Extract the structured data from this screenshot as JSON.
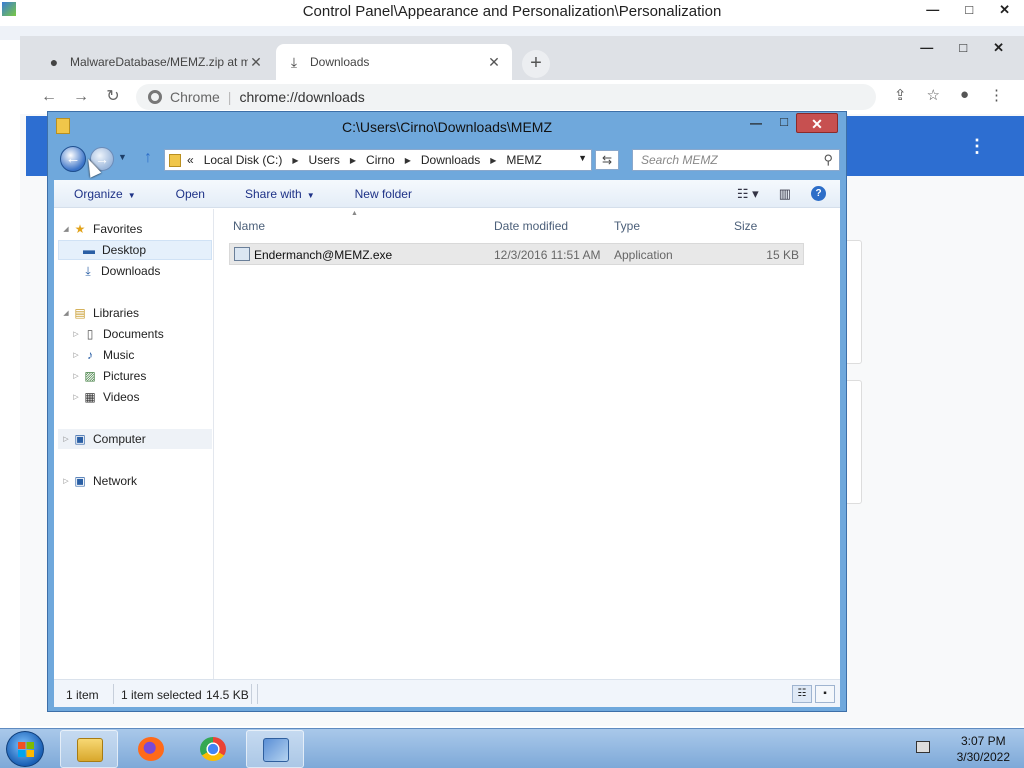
{
  "control_panel": {
    "title": "Control Panel\\Appearance and Personalization\\Personalization",
    "minimize": "—",
    "maximize": "□",
    "close": "✕"
  },
  "chrome": {
    "tabs": [
      {
        "label": "MalwareDatabase/MEMZ.zip at m",
        "icon": "github-icon",
        "close": "✕"
      },
      {
        "label": "Downloads",
        "icon": "download-icon",
        "close": "✕"
      }
    ],
    "new_tab": "+",
    "minimize": "—",
    "maximize": "□",
    "close": "✕",
    "omnibox": {
      "scheme_label": "Chrome",
      "separator": "|",
      "url": "chrome://downloads"
    },
    "downloads_menu": "⋮"
  },
  "explorer": {
    "title": "C:\\Users\\Cirno\\Downloads\\MEMZ",
    "minimize": "—",
    "maximize": "□",
    "close": "✕",
    "address": {
      "prefix": "«",
      "crumbs": [
        "Local Disk (C:)",
        "Users",
        "Cirno",
        "Downloads",
        "MEMZ"
      ]
    },
    "search_placeholder": "Search MEMZ",
    "commands": {
      "organize": "Organize",
      "open": "Open",
      "share_with": "Share with",
      "new_folder": "New folder"
    },
    "nav": {
      "favorites": "Favorites",
      "desktop": "Desktop",
      "downloads": "Downloads",
      "libraries": "Libraries",
      "documents": "Documents",
      "music": "Music",
      "pictures": "Pictures",
      "videos": "Videos",
      "computer": "Computer",
      "network": "Network"
    },
    "columns": {
      "name": "Name",
      "date": "Date modified",
      "type": "Type",
      "size": "Size"
    },
    "files": [
      {
        "name": "Endermanch@MEMZ.exe",
        "date": "12/3/2016 11:51 AM",
        "type": "Application",
        "size": "15 KB"
      }
    ],
    "status": {
      "count": "1 item",
      "selected": "1 item selected",
      "selected_size": "14.5 KB"
    }
  },
  "taskbar": {
    "apps": [
      "file-explorer",
      "firefox",
      "chrome",
      "control-panel"
    ],
    "time": "3:07 PM",
    "date": "3/30/2022"
  },
  "colors": {
    "explorer_frame": "#6fa8dc",
    "close_button": "#c75050",
    "downloads_header": "#2d6ed1",
    "taskbar": "#7ea9d8"
  }
}
